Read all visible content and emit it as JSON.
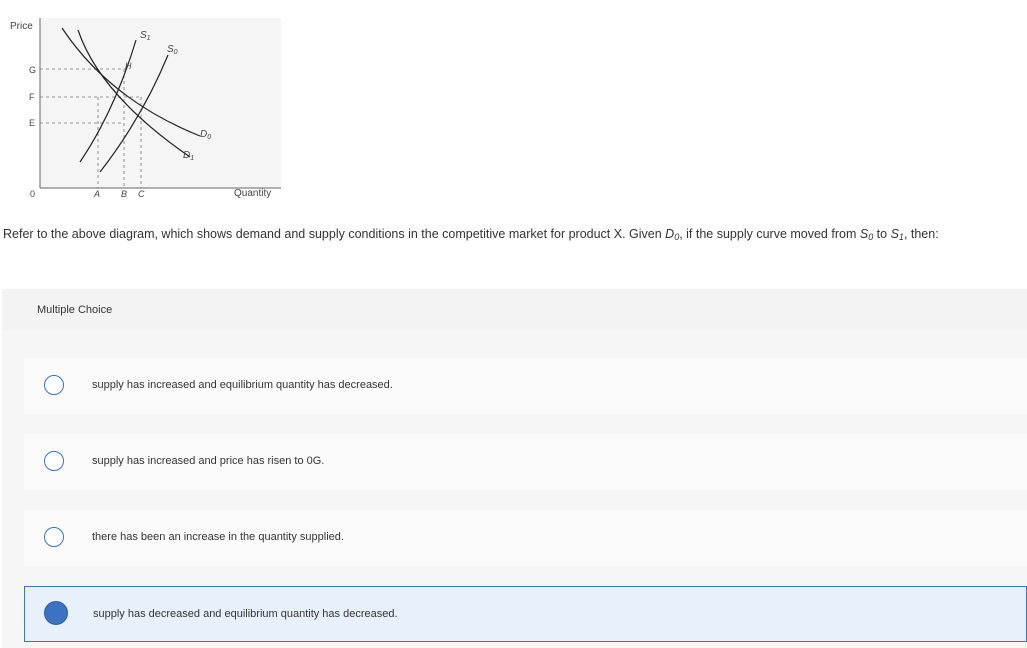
{
  "diagram": {
    "price_label": "Price",
    "quantity_label": "Quantity",
    "origin_label": "0",
    "price_ticks": [
      "G",
      "F",
      "E"
    ],
    "quantity_ticks": [
      "A",
      "B",
      "C"
    ],
    "point_label": "H",
    "curve_labels": {
      "s1_main": "S",
      "s1_sub": "1",
      "s0_main": "S",
      "s0_sub": "0",
      "d0_main": "D",
      "d0_sub": "0",
      "d1_main": "D",
      "d1_sub": "1"
    }
  },
  "question": {
    "text_before": "Refer to the above diagram, which shows demand and supply conditions in the competitive market for product X. Given ",
    "d0_main": "D",
    "d0_sub": "0",
    "text_mid1": ", if the supply curve moved from ",
    "s0_main": "S",
    "s0_sub": "0",
    "text_mid2": " to ",
    "s1_main": "S",
    "s1_sub": "1",
    "text_after": ", then:"
  },
  "multiple_choice": {
    "label": "Multiple Choice",
    "options": [
      {
        "text": "supply has increased and equilibrium quantity has decreased.",
        "selected": false
      },
      {
        "text": "supply has increased and price has risen to 0G.",
        "selected": false
      },
      {
        "text": "there has been an increase in the quantity supplied.",
        "selected": false
      },
      {
        "text": "supply has decreased and equilibrium quantity has decreased.",
        "selected": true
      }
    ]
  },
  "colors": {
    "accent": "#3b73c2",
    "selected_bg": "#e8f1fb"
  }
}
